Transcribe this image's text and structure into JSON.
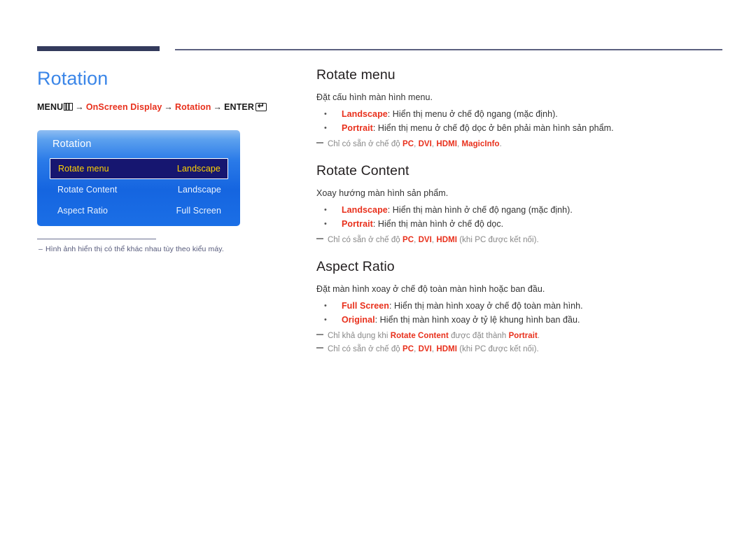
{
  "header": {
    "rule_color": "#333a5c",
    "thin_rule_color": "#5b6080"
  },
  "left": {
    "page_title": "Rotation",
    "breadcrumb": {
      "menu_label": "MENU",
      "menu_icon": "menu-bars-icon",
      "arrow": "→",
      "step1": "OnScreen Display",
      "step2": "Rotation",
      "enter_label": "ENTER",
      "enter_icon": "enter-key-icon"
    },
    "osd": {
      "title": "Rotation",
      "rows": [
        {
          "label": "Rotate menu",
          "value": "Landscape",
          "selected": true
        },
        {
          "label": "Rotate Content",
          "value": "Landscape",
          "selected": false
        },
        {
          "label": "Aspect Ratio",
          "value": "Full Screen",
          "selected": false
        }
      ]
    },
    "footnote": {
      "dash": "–",
      "text": "Hình ảnh hiển thị có thể khác nhau tùy theo kiểu máy."
    }
  },
  "right": {
    "sections": [
      {
        "heading": "Rotate menu",
        "intro": "Đặt cấu hình màn hình menu.",
        "options": [
          {
            "term": "Landscape",
            "desc": ": Hiển thị menu ở chế độ ngang (mặc định)."
          },
          {
            "term": "Portrait",
            "desc": ": Hiển thị menu ở chế độ dọc ở bên phải màn hình sản phẩm."
          }
        ],
        "notes": [
          {
            "lead": "Chỉ có sẵn ở chế độ ",
            "terms": [
              "PC",
              "DVI",
              "HDMI",
              "MagicInfo"
            ],
            "tail": "."
          }
        ]
      },
      {
        "heading": "Rotate Content",
        "intro": "Xoay hướng màn hình sản phẩm.",
        "options": [
          {
            "term": "Landscape",
            "desc": ": Hiển thị màn hình ở chế độ ngang (mặc định)."
          },
          {
            "term": "Portrait",
            "desc": ": Hiển thị màn hình ở chế độ dọc."
          }
        ],
        "notes": [
          {
            "lead": "Chỉ có sẵn ở chế độ ",
            "terms": [
              "PC",
              "DVI",
              "HDMI"
            ],
            "tail": " (khi PC được kết nối)."
          }
        ]
      },
      {
        "heading": "Aspect Ratio",
        "intro": "Đặt màn hình xoay ở chế độ toàn màn hình hoặc ban đầu.",
        "options": [
          {
            "term": "Full Screen",
            "desc": ": Hiển thị màn hình xoay ở chế độ toàn màn hình."
          },
          {
            "term": "Original",
            "desc": ": Hiển thị màn hình xoay ở tỷ lệ khung hình ban đầu."
          }
        ],
        "notes": [
          {
            "lead": "Chỉ khả dụng khi ",
            "terms": [
              "Rotate Content"
            ],
            "mid": " được đặt thành ",
            "terms2": [
              "Portrait"
            ],
            "tail": "."
          },
          {
            "lead": "Chỉ có sẵn ở chế độ ",
            "terms": [
              "PC",
              "DVI",
              "HDMI"
            ],
            "tail": " (khi PC được kết nối)."
          }
        ]
      }
    ]
  },
  "colors": {
    "accent_blue": "#3b86e8",
    "accent_red": "#e8301c",
    "osd_blue": "#1565e0",
    "osd_selected": "#161670",
    "osd_selected_text": "#ffd200",
    "header_navy": "#333a5c"
  }
}
